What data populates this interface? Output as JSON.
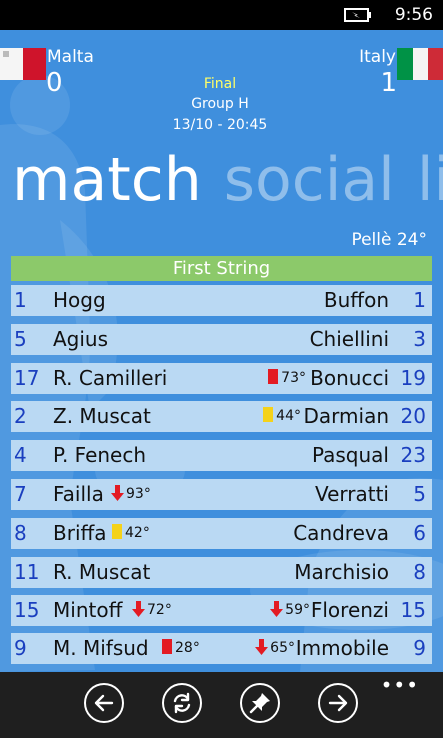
{
  "status": {
    "time": "9:56"
  },
  "match": {
    "home": {
      "name": "Malta",
      "score": "0"
    },
    "away": {
      "name": "Italy",
      "score": "1"
    },
    "status": "Final",
    "group": "Group H",
    "datetime": "13/10 - 20:45",
    "goal": "Pellè 24°"
  },
  "tabs": [
    "match",
    "social",
    "liv"
  ],
  "section_title": "First String",
  "lineup": [
    {
      "home_num": "1",
      "home_name": "Hogg",
      "home_event": "",
      "home_event_type": "",
      "away_name": "Buffon",
      "away_num": "1",
      "away_event": "",
      "away_event_type": ""
    },
    {
      "home_num": "5",
      "home_name": "Agius",
      "home_event": "",
      "home_event_type": "",
      "away_name": "Chiellini",
      "away_num": "3",
      "away_event": "",
      "away_event_type": ""
    },
    {
      "home_num": "17",
      "home_name": "R. Camilleri",
      "home_event": "",
      "home_event_type": "",
      "away_name": "Bonucci",
      "away_num": "19",
      "away_event": "73°",
      "away_event_type": "red-card"
    },
    {
      "home_num": "2",
      "home_name": "Z. Muscat",
      "home_event": "",
      "home_event_type": "",
      "away_name": "Darmian",
      "away_num": "20",
      "away_event": "44°",
      "away_event_type": "yellow-card"
    },
    {
      "home_num": "4",
      "home_name": "P. Fenech",
      "home_event": "",
      "home_event_type": "",
      "away_name": "Pasqual",
      "away_num": "23",
      "away_event": "",
      "away_event_type": ""
    },
    {
      "home_num": "7",
      "home_name": "Failla",
      "home_event": "93°",
      "home_event_type": "sub-out",
      "away_name": "Verratti",
      "away_num": "5",
      "away_event": "",
      "away_event_type": ""
    },
    {
      "home_num": "8",
      "home_name": "Briffa",
      "home_event": "42°",
      "home_event_type": "yellow-card",
      "away_name": "Candreva",
      "away_num": "6",
      "away_event": "",
      "away_event_type": ""
    },
    {
      "home_num": "11",
      "home_name": "R. Muscat",
      "home_event": "",
      "home_event_type": "",
      "away_name": "Marchisio",
      "away_num": "8",
      "away_event": "",
      "away_event_type": ""
    },
    {
      "home_num": "15",
      "home_name": "Mintoff",
      "home_event": "72°",
      "home_event_type": "sub-out",
      "away_name": "Florenzi",
      "away_num": "15",
      "away_event": "59°",
      "away_event_type": "sub-out"
    },
    {
      "home_num": "9",
      "home_name": "M. Mifsud",
      "home_event": "28°",
      "home_event_type": "red-card",
      "away_name": "Immobile",
      "away_num": "9",
      "away_event": "65°",
      "away_event_type": "sub-out"
    }
  ],
  "appbar": {
    "buttons": [
      "back-icon",
      "refresh-icon",
      "pin-icon",
      "forward-icon"
    ],
    "more": "•••"
  },
  "colors": {
    "background": "#3f8fdd",
    "row": "#bad9f3",
    "section": "#8cc96a",
    "number": "#1a3fbf",
    "final": "#ffff66"
  }
}
